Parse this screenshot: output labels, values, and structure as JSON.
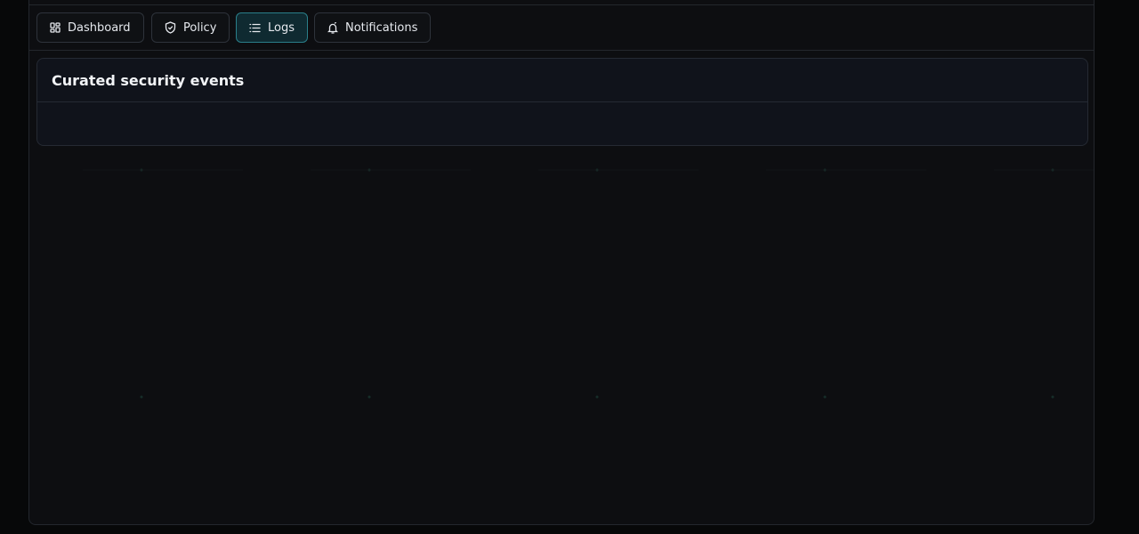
{
  "tabs": [
    {
      "label": "Dashboard",
      "icon": "dashboard-icon",
      "active": false
    },
    {
      "label": "Policy",
      "icon": "shield-icon",
      "active": false
    },
    {
      "label": "Logs",
      "icon": "list-icon",
      "active": true
    },
    {
      "label": "Notifications",
      "icon": "bell-icon",
      "active": false
    }
  ],
  "panel": {
    "title": "Curated security events"
  },
  "colors": {
    "accent": "#2a7f8a",
    "background": "#0d0e11",
    "panel": "#10131b"
  }
}
